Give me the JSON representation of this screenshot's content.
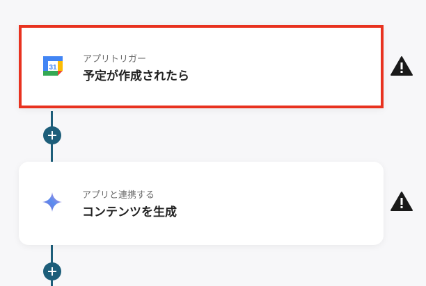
{
  "flow": {
    "steps": [
      {
        "subtitle": "アプリトリガー",
        "title": "予定が作成されたら",
        "icon": "google-calendar-icon",
        "calendar_day": "31",
        "selected": true
      },
      {
        "subtitle": "アプリと連携する",
        "title": "コンテンツを生成",
        "icon": "gemini-sparkle-icon",
        "selected": false
      }
    ]
  },
  "colors": {
    "connector": "#1d5e7a",
    "selection_border": "#e8321f",
    "warning": "#1a1a1a"
  }
}
